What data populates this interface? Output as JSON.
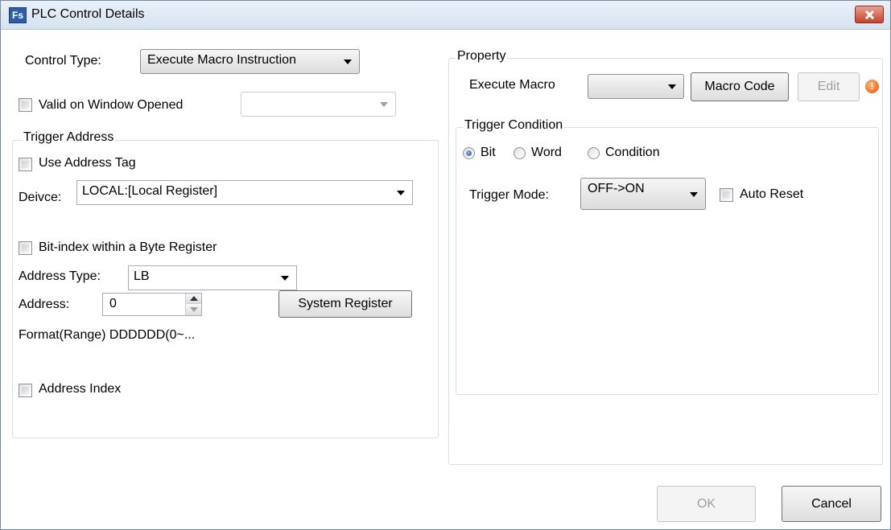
{
  "window": {
    "title": "PLC Control Details",
    "icon_text": "Fs"
  },
  "control_type": {
    "label": "Control Type:",
    "value": "Execute Macro Instruction"
  },
  "valid_on_window_opened": {
    "label": "Valid on Window Opened",
    "checked": false,
    "value": ""
  },
  "trigger_address": {
    "title": "Trigger Address",
    "use_address_tag": {
      "label": "Use Address Tag",
      "checked": false
    },
    "device": {
      "label": "Deivce:",
      "value": "LOCAL:[Local Register]"
    },
    "bit_index": {
      "label": "Bit-index within a Byte Register",
      "checked": false
    },
    "address_type": {
      "label": "Address Type:",
      "value": "LB"
    },
    "address": {
      "label": "Address:",
      "value": "0"
    },
    "system_register_button": "System Register",
    "format_range": "Format(Range) DDDDDD(0~...",
    "address_index": {
      "label": "Address Index",
      "checked": false
    }
  },
  "property": {
    "title": "Property",
    "execute_macro": {
      "label": "Execute Macro",
      "value": ""
    },
    "macro_code_button": "Macro Code",
    "edit_button": "Edit",
    "warning_icon": "warning-icon",
    "trigger_condition": {
      "title": "Trigger Condition",
      "options": [
        "Bit",
        "Word",
        "Condition"
      ],
      "selected": "Bit",
      "trigger_mode": {
        "label": "Trigger Mode:",
        "value": "OFF->ON"
      },
      "auto_reset": {
        "label": "Auto Reset",
        "checked": false
      }
    }
  },
  "footer": {
    "ok": "OK",
    "cancel": "Cancel"
  },
  "colors": {
    "close_button": "#c7412c",
    "warning": "#e2580f",
    "radio_selected": "#1f4f9c"
  }
}
